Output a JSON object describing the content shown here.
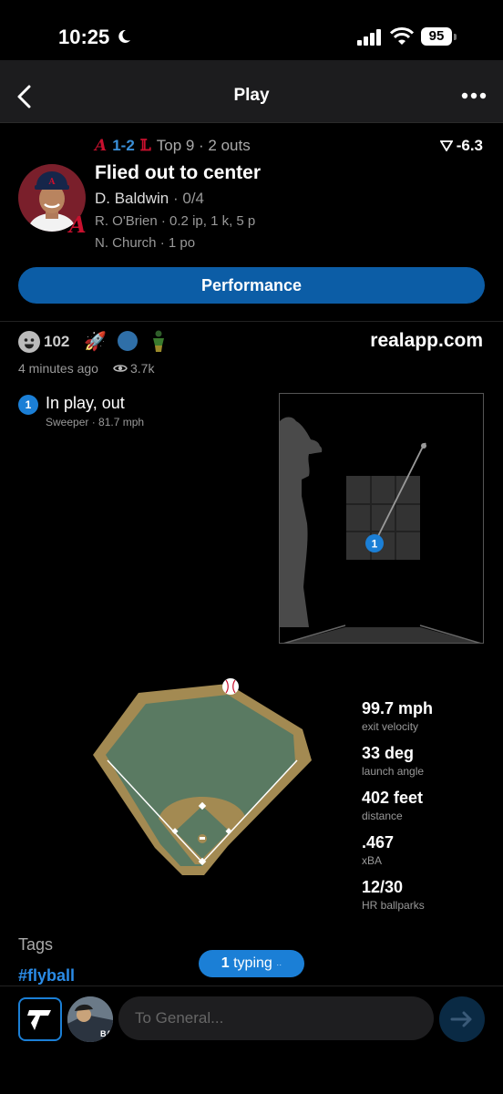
{
  "status": {
    "time": "10:25",
    "battery": "95"
  },
  "nav": {
    "title": "Play"
  },
  "header": {
    "away_score": "1-2",
    "inning": "Top 9 · 2 outs",
    "wpa": "-6.3",
    "result": "Flied out to center",
    "batter_name": "D. Baldwin",
    "batter_line": " · 0/4",
    "pitcher": "R. O'Brien · 0.2 ip, 1 k, 5 p",
    "fielder": "N. Church · 1 po",
    "performance_label": "Performance"
  },
  "social": {
    "reaction_count": "102",
    "site": "realapp.com",
    "time_ago": "4 minutes ago",
    "views": "3.7k"
  },
  "pitch": {
    "number": "1",
    "title": "In play, out",
    "subtitle": "Sweeper · 81.7 mph"
  },
  "hit_stats": [
    {
      "value": "99.7 mph",
      "label": "exit velocity"
    },
    {
      "value": "33 deg",
      "label": "launch angle"
    },
    {
      "value": "402 feet",
      "label": "distance"
    },
    {
      "value": ".467",
      "label": "xBA"
    },
    {
      "value": "12/30",
      "label": "HR ballparks"
    }
  ],
  "tags": {
    "heading": "Tags",
    "items": [
      "#flyball"
    ]
  },
  "typing": {
    "count": "1",
    "label": " typing"
  },
  "composer": {
    "placeholder": "To General..."
  },
  "colors": {
    "accent": "#1b7fd6",
    "button": "#0c5da6",
    "braves_red": "#c8102e"
  },
  "icons": [
    "moon-icon",
    "signal-icon",
    "wifi-icon",
    "back-icon",
    "more-icon",
    "eye-icon",
    "rocket-icon",
    "send-icon"
  ]
}
